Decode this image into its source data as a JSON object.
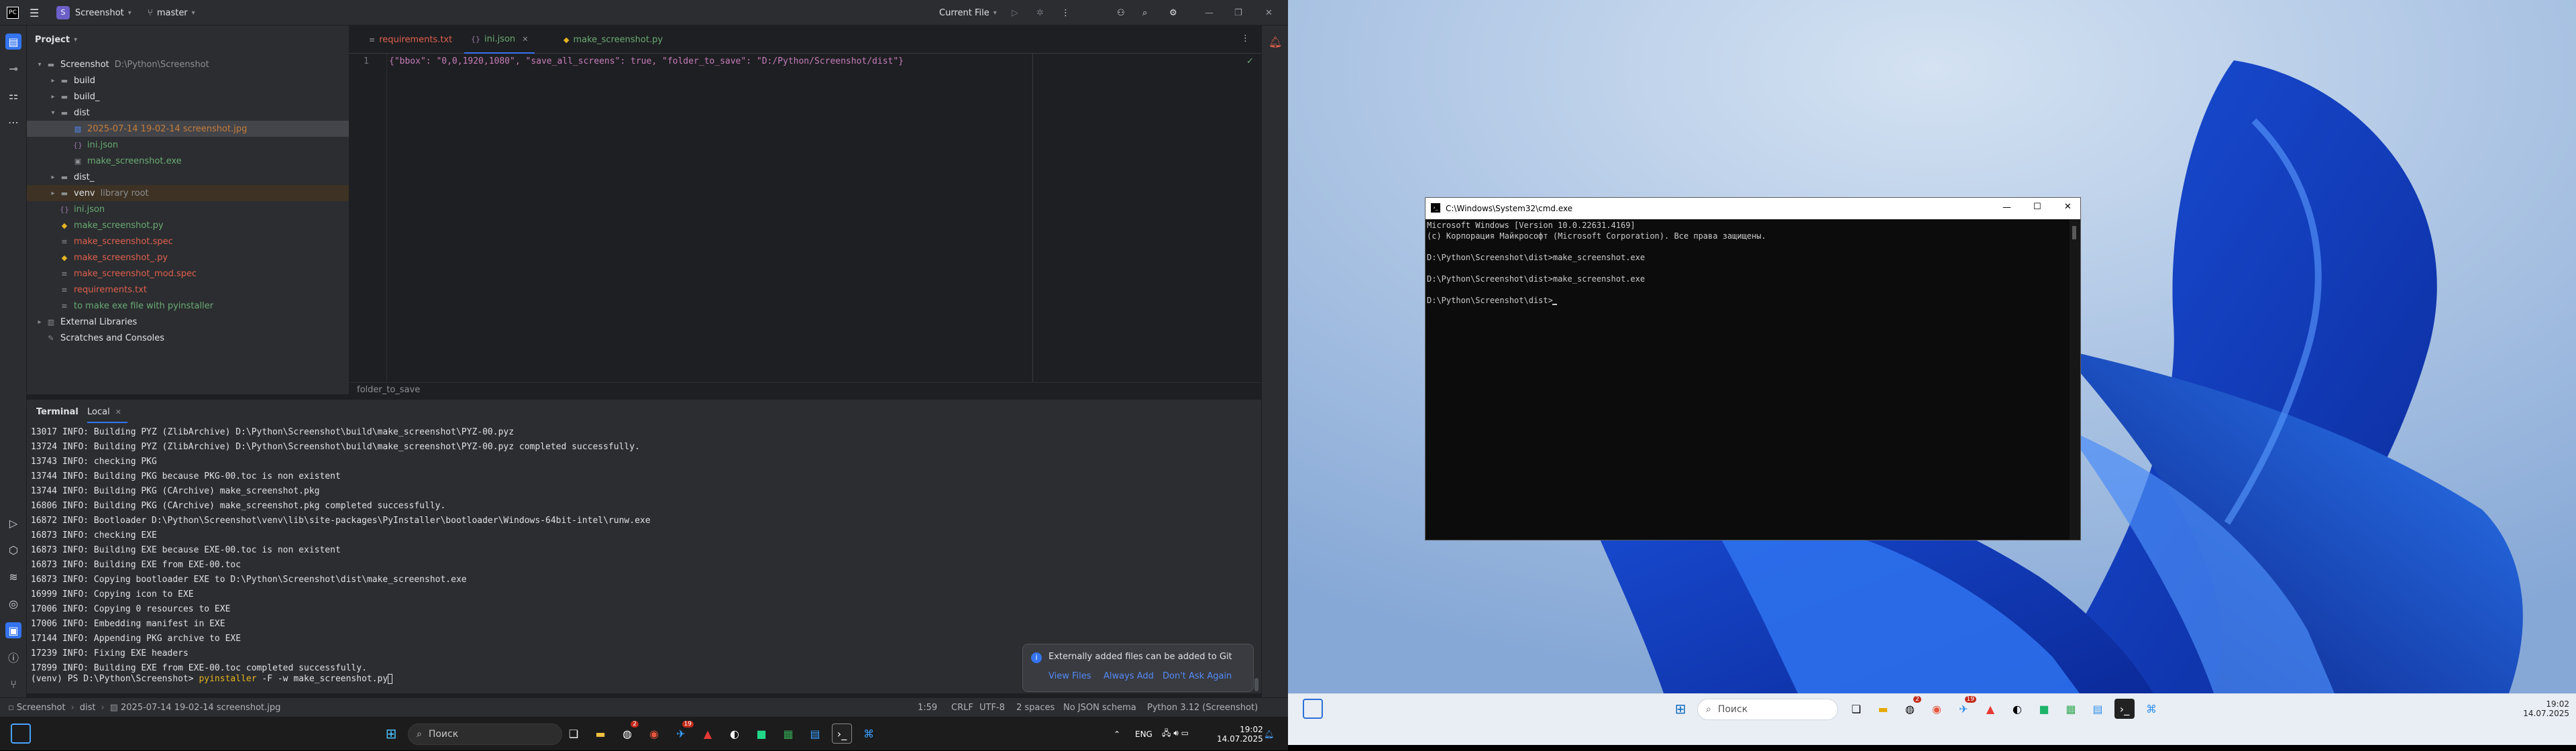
{
  "ide": {
    "project_badge": "S",
    "project_name": "Screenshot",
    "branch": "master",
    "run_config": "Current File",
    "panel_title": "Project",
    "tree": [
      {
        "label": "Screenshot",
        "extra": "D:\\Python\\Screenshot",
        "depth": 0,
        "arrow": "open",
        "icon": "folder-icon",
        "color": "#dfe1e5"
      },
      {
        "label": "build",
        "extra": "",
        "depth": 1,
        "arrow": "closed",
        "icon": "folder-icon",
        "color": "#dfe1e5"
      },
      {
        "label": "build_",
        "extra": "",
        "depth": 1,
        "arrow": "closed",
        "icon": "folder-icon",
        "color": "#dfe1e5"
      },
      {
        "label": "dist",
        "extra": "",
        "depth": 1,
        "arrow": "open",
        "icon": "folder-icon",
        "color": "#dfe1e5"
      },
      {
        "label": "2025-07-14 19-02-14 screenshot.jpg",
        "extra": "",
        "depth": 2,
        "arrow": "",
        "icon": "image-file-icon",
        "color": "#c77d3a",
        "selected": true
      },
      {
        "label": "ini.json",
        "extra": "",
        "depth": 2,
        "arrow": "",
        "icon": "json-file-icon",
        "color": "#6aab73"
      },
      {
        "label": "make_screenshot.exe",
        "extra": "",
        "depth": 2,
        "arrow": "",
        "icon": "exe-file-icon",
        "color": "#6aab73"
      },
      {
        "label": "dist_",
        "extra": "",
        "depth": 1,
        "arrow": "closed",
        "icon": "folder-icon",
        "color": "#dfe1e5"
      },
      {
        "label": "venv",
        "extra": "library root",
        "depth": 1,
        "arrow": "closed",
        "icon": "folder-icon",
        "color": "#dfe1e5",
        "highlight": true
      },
      {
        "label": "ini.json",
        "extra": "",
        "depth": 1,
        "arrow": "",
        "icon": "json-file-icon",
        "color": "#6aab73"
      },
      {
        "label": "make_screenshot.py",
        "extra": "",
        "depth": 1,
        "arrow": "",
        "icon": "python-file-icon",
        "color": "#6aab73"
      },
      {
        "label": "make_screenshot.spec",
        "extra": "",
        "depth": 1,
        "arrow": "",
        "icon": "text-file-icon",
        "color": "#e0604f"
      },
      {
        "label": "make_screenshot_.py",
        "extra": "",
        "depth": 1,
        "arrow": "",
        "icon": "python-file-icon",
        "color": "#e0604f"
      },
      {
        "label": "make_screenshot_mod.spec",
        "extra": "",
        "depth": 1,
        "arrow": "",
        "icon": "text-file-icon",
        "color": "#e0604f"
      },
      {
        "label": "requirements.txt",
        "extra": "",
        "depth": 1,
        "arrow": "",
        "icon": "text-file-icon",
        "color": "#e0604f"
      },
      {
        "label": "to make exe file with pyinstaller",
        "extra": "",
        "depth": 1,
        "arrow": "",
        "icon": "text-file-icon",
        "color": "#6aab73"
      },
      {
        "label": "External Libraries",
        "extra": "",
        "depth": 0,
        "arrow": "closed",
        "icon": "library-icon",
        "color": "#dfe1e5"
      },
      {
        "label": "Scratches and Consoles",
        "extra": "",
        "depth": 0,
        "arrow": "",
        "icon": "scratch-icon",
        "color": "#dfe1e5"
      }
    ],
    "tabs": [
      {
        "label": "requirements.txt",
        "color": "#e0604f",
        "active": false
      },
      {
        "label": "ini.json",
        "color": "#6aab73",
        "active": true
      },
      {
        "label": "make_screenshot.py",
        "color": "#6aab73",
        "active": false
      }
    ],
    "editor_line_number": "1",
    "editor_code": "{\"bbox\": \"0,0,1920,1080\", \"save_all_screens\": true, \"folder_to_save\": \"D:/Python/Screenshot/dist\"}",
    "editor_breadcrumb": "folder_to_save",
    "terminal_tab": "Terminal",
    "terminal_local_tab": "Local",
    "terminal_lines": [
      "13017 INFO: Building PYZ (ZlibArchive) D:\\Python\\Screenshot\\build\\make_screenshot\\PYZ-00.pyz",
      "13724 INFO: Building PYZ (ZlibArchive) D:\\Python\\Screenshot\\build\\make_screenshot\\PYZ-00.pyz completed successfully.",
      "13743 INFO: checking PKG",
      "13744 INFO: Building PKG because PKG-00.toc is non existent",
      "13744 INFO: Building PKG (CArchive) make_screenshot.pkg",
      "16806 INFO: Building PKG (CArchive) make_screenshot.pkg completed successfully.",
      "16872 INFO: Bootloader D:\\Python\\Screenshot\\venv\\lib\\site-packages\\PyInstaller\\bootloader\\Windows-64bit-intel\\runw.exe",
      "16873 INFO: checking EXE",
      "16873 INFO: Building EXE because EXE-00.toc is non existent",
      "16873 INFO: Building EXE from EXE-00.toc",
      "16873 INFO: Copying bootloader EXE to D:\\Python\\Screenshot\\dist\\make_screenshot.exe",
      "16999 INFO: Copying icon to EXE",
      "17006 INFO: Copying 0 resources to EXE",
      "17006 INFO: Embedding manifest in EXE",
      "17144 INFO: Appending PKG archive to EXE",
      "17239 INFO: Fixing EXE headers",
      "17899 INFO: Building EXE from EXE-00.toc completed successfully."
    ],
    "prompt_prefix": "(venv) PS D:\\Python\\Screenshot> ",
    "prompt_cmd": "pyinstaller",
    "prompt_args": " -F -w make_screenshot.py",
    "notification": {
      "text": "Externally added files can be added to Git",
      "actions": [
        "View Files",
        "Always Add",
        "Don't Ask Again"
      ]
    },
    "status": {
      "crumb": [
        "Screenshot",
        "dist",
        "2025-07-14 19-02-14 screenshot.jpg"
      ],
      "position": "1:59",
      "line_ending": "CRLF",
      "encoding": "UTF-8",
      "indent": "2 spaces",
      "schema": "No JSON schema",
      "interpreter": "Python 3.12 (Screenshot)"
    }
  },
  "taskbar_left": {
    "search_placeholder": "Поиск",
    "lang": "ENG",
    "time": "19:02",
    "date": "14.07.2025",
    "badge_count": "2",
    "badge_count_2": "19"
  },
  "cmd": {
    "title": "C:\\Windows\\System32\\cmd.exe",
    "lines": [
      "Microsoft Windows [Version 10.0.22631.4169]",
      "(c) Корпорация Майкрософт (Microsoft Corporation). Все права защищены.",
      "",
      "D:\\Python\\Screenshot\\dist>make_screenshot.exe",
      "",
      "D:\\Python\\Screenshot\\dist>make_screenshot.exe",
      "",
      "D:\\Python\\Screenshot\\dist>"
    ]
  },
  "taskbar_right": {
    "search_placeholder": "Поиск",
    "time": "19:02",
    "date": "14.07.2025",
    "badge_count": "2",
    "badge_count_2": "19"
  },
  "colors": {
    "ide_bg": "#1e1f22",
    "panel_bg": "#2b2d30",
    "accent": "#3574f0",
    "git_added": "#6aab73",
    "git_unversioned": "#e0604f"
  }
}
